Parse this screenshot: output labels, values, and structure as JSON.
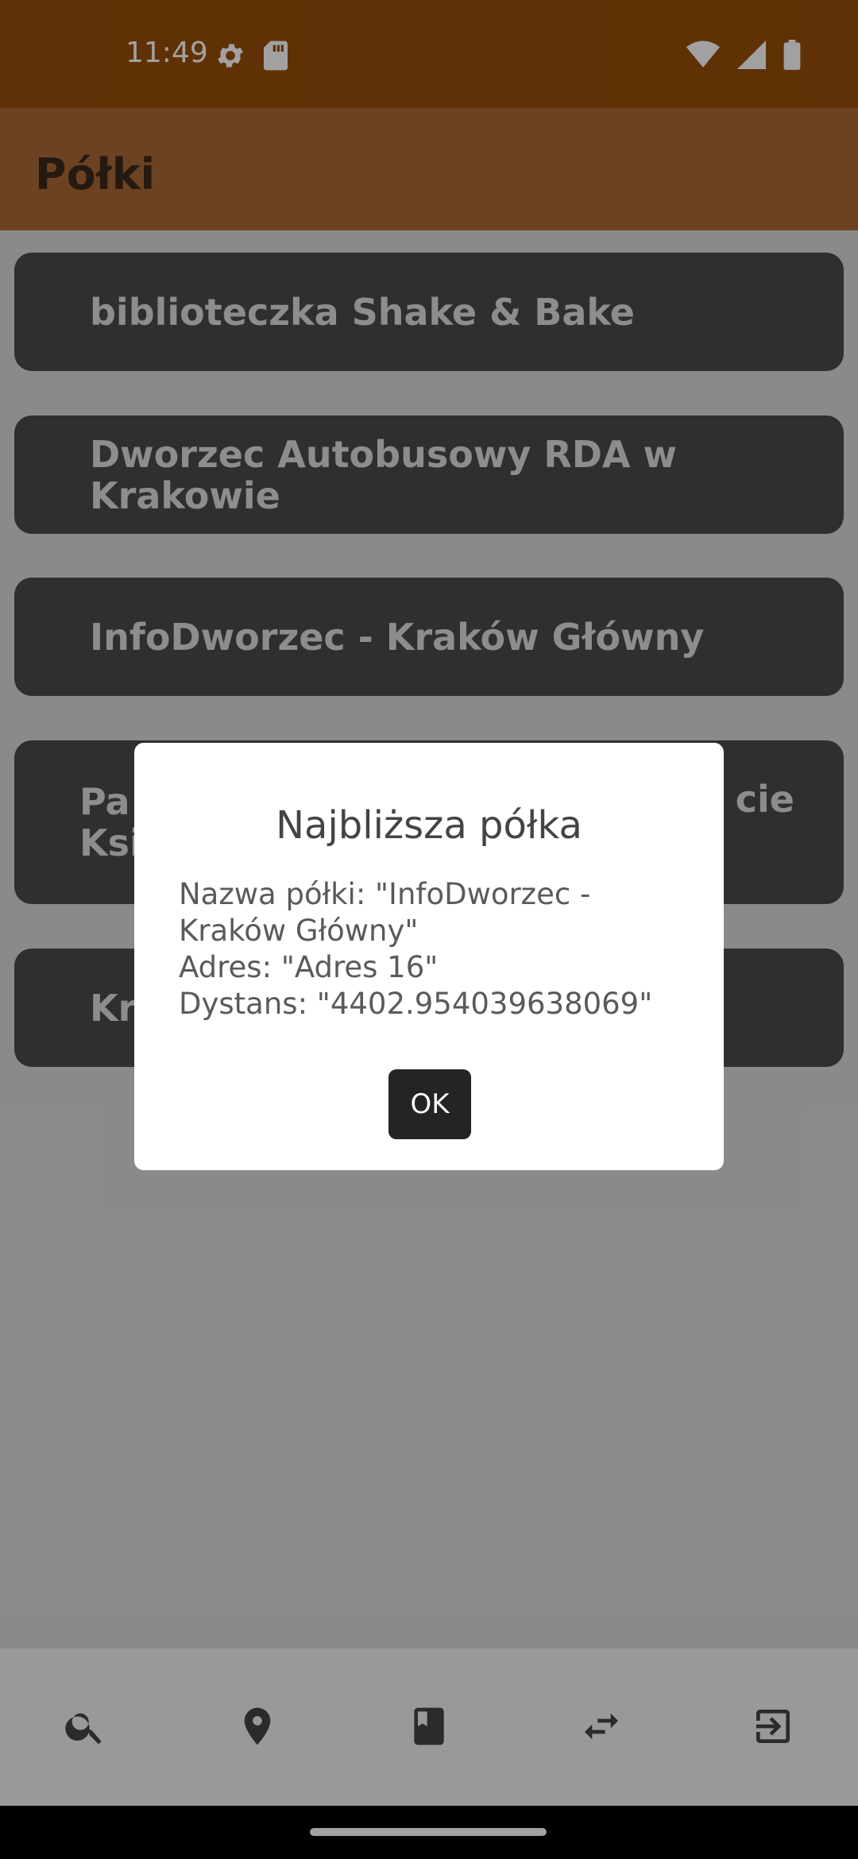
{
  "status_bar": {
    "time": "11:49",
    "left_icons": [
      "settings-gear-icon",
      "sd-card-icon"
    ],
    "right_icons": [
      "wifi-icon",
      "cellular-signal-icon",
      "battery-icon"
    ]
  },
  "app_bar": {
    "title": "Półki"
  },
  "shelves": [
    {
      "label": "biblioteczka Shake & Bake"
    },
    {
      "label": "Dworzec Autobusowy RDA w Krakowie"
    },
    {
      "label": "InfoDworzec - Kraków Główny"
    },
    {
      "label_visible_left": "Pa\nKsi",
      "label_visible_right": "cie"
    },
    {
      "label_visible_left": "Kra"
    }
  ],
  "dialog": {
    "title": "Najbliższa półka",
    "line_name": "Nazwa półki: \"InfoDworzec - Kraków Główny\"",
    "line_address": "Adres: \"Adres 16\"",
    "line_distance": "Dystans: \"4402.954039638069\"",
    "ok_label": "OK"
  },
  "bottom_nav": {
    "items": [
      "search-icon",
      "location-pin-icon",
      "book-icon",
      "swap-arrows-icon",
      "logout-icon"
    ]
  },
  "colors": {
    "status_bar": "#9a4f0b",
    "app_bar": "#ac6b37",
    "shelf_button": "#4b4a4f",
    "ok_button": "#252323"
  }
}
